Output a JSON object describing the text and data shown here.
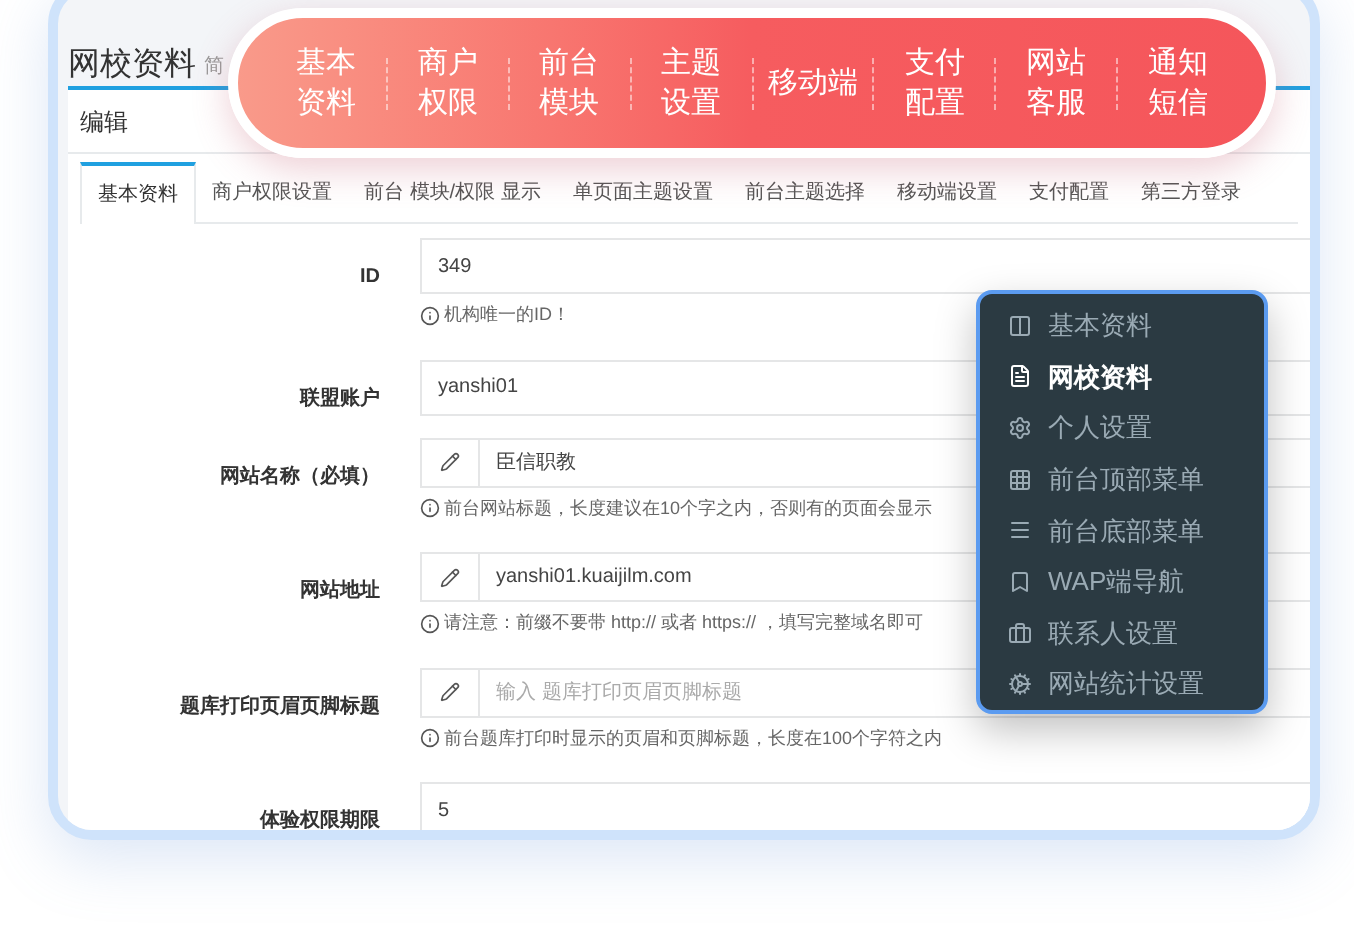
{
  "page": {
    "title": "网校资料",
    "subtitle": "简"
  },
  "quick_nav": [
    {
      "lines": [
        "基本",
        "资料"
      ]
    },
    {
      "lines": [
        "商户",
        "权限"
      ]
    },
    {
      "lines": [
        "前台",
        "模块"
      ]
    },
    {
      "lines": [
        "主题",
        "设置"
      ]
    },
    {
      "lines": [
        "移动端"
      ]
    },
    {
      "lines": [
        "支付",
        "配置"
      ]
    },
    {
      "lines": [
        "网站",
        "客服"
      ]
    },
    {
      "lines": [
        "通知",
        "短信"
      ]
    }
  ],
  "panel_title": "编辑",
  "tabs": [
    {
      "label": "基本资料",
      "selected": true
    },
    {
      "label": "商户权限设置",
      "selected": false
    },
    {
      "label": "前台 模块/权限 显示",
      "selected": false
    },
    {
      "label": "单页面主题设置",
      "selected": false
    },
    {
      "label": "前台主题选择",
      "selected": false
    },
    {
      "label": "移动端设置",
      "selected": false
    },
    {
      "label": "支付配置",
      "selected": false
    },
    {
      "label": "第三方登录",
      "selected": false
    }
  ],
  "fields": [
    {
      "label": "ID",
      "kind": "plain",
      "value": "349",
      "help": "机构唯一的ID！"
    },
    {
      "label": "联盟账户",
      "kind": "plain",
      "value": "yanshi01"
    },
    {
      "label": "网站名称（必填）",
      "kind": "pencil",
      "value": "臣信职教",
      "help": "前台网站标题，长度建议在10个字之内，否则有的页面会显示"
    },
    {
      "label": "网站地址",
      "kind": "pencil",
      "value": "yanshi01.kuaijilm.com",
      "help": "请注意：前缀不要带 http:// 或者 https:// ，填写完整域名即可"
    },
    {
      "label": "题库打印页眉页脚标题",
      "kind": "pencil",
      "placeholder": "输入 题库打印页眉页脚标题",
      "help": "前台题库打印时显示的页眉和页脚标题，长度在100个字符之内"
    },
    {
      "label": "体验权限期限",
      "kind": "plain",
      "value": "5"
    }
  ],
  "menu": [
    {
      "label": "基本资料",
      "selected": false
    },
    {
      "label": "网校资料",
      "selected": true
    },
    {
      "label": "个人设置",
      "selected": false
    },
    {
      "label": "前台顶部菜单",
      "selected": false
    },
    {
      "label": "前台底部菜单",
      "selected": false
    },
    {
      "label": "WAP端导航",
      "selected": false
    },
    {
      "label": "联系人设置",
      "selected": false
    },
    {
      "label": "网站统计设置",
      "selected": false
    }
  ]
}
